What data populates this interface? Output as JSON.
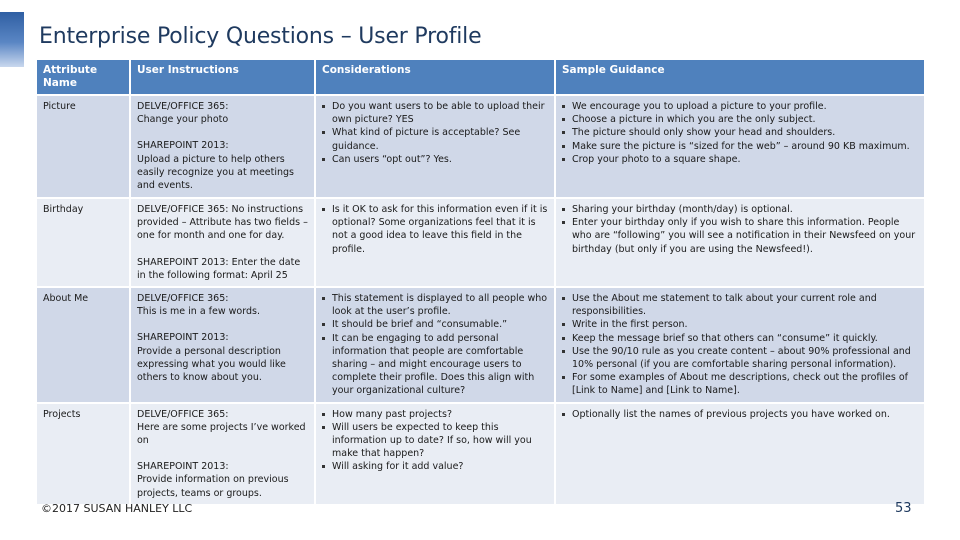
{
  "slide": {
    "title": "Enterprise Policy Questions – User Profile",
    "footer": "©2017 SUSAN HANLEY LLC",
    "page_number": "53",
    "colors": {
      "header_fill": "#4f81bd",
      "row_dark": "#d0d8e8",
      "row_light": "#e9edf4",
      "title_color": "#1f3a5f"
    }
  },
  "table": {
    "headers": [
      "Attribute Name",
      "User Instructions",
      "Considerations",
      "Sample Guidance"
    ],
    "rows": [
      {
        "attribute": "Picture",
        "instructions": [
          "DELVE/OFFICE 365:\nChange your photo",
          "SHAREPOINT 2013:\nUpload a picture to help others easily recognize you at meetings and events."
        ],
        "considerations": [
          "Do you want users to be able to upload their own picture? YES",
          "What kind of picture is acceptable? See guidance.",
          "Can users “opt out”? Yes."
        ],
        "guidance": [
          "We encourage you to upload a picture to your profile.",
          "Choose a picture in which you are the only subject.",
          "The picture should only show your head and shoulders.",
          "Make sure the picture is “sized for the web” – around 90 KB maximum.",
          "Crop your photo to a square shape."
        ]
      },
      {
        "attribute": "Birthday",
        "instructions": [
          "DELVE/OFFICE 365: No instructions provided – Attribute has two fields – one for month and one for day.",
          "SHAREPOINT 2013: Enter the date in the following format: April 25"
        ],
        "considerations": [
          "Is it OK to ask for this information even if it is optional? Some organizations feel that it is not a good idea to leave this field in the profile."
        ],
        "guidance": [
          "Sharing your birthday (month/day) is optional.",
          "Enter your birthday only if you wish to share this information. People who are “following” you will see a notification in their Newsfeed on your birthday (but only if you are using the Newsfeed!)."
        ]
      },
      {
        "attribute": "About Me",
        "instructions": [
          "DELVE/OFFICE 365:\nThis is me in a few words.",
          "SHAREPOINT 2013:\nProvide a personal description expressing what you would like others to know about you."
        ],
        "considerations": [
          "This statement is displayed to all people who look at the user’s profile.",
          "It should be brief and “consumable.”",
          "It can be engaging to add personal information that people are comfortable sharing – and might encourage users to complete their profile. Does this align with your organizational culture?"
        ],
        "guidance": [
          "Use the About me statement to talk about your current role and responsibilities.",
          "Write in the first person.",
          "Keep the message brief so that others can “consume” it quickly.",
          "Use the 90/10 rule as you create content – about 90% professional and 10% personal (if you are comfortable sharing personal information).",
          "For some examples of About me descriptions, check out the profiles of [Link to Name] and [Link to Name]."
        ]
      },
      {
        "attribute": "Projects",
        "instructions": [
          "DELVE/OFFICE 365:\nHere are some projects I’ve worked on",
          "SHAREPOINT 2013:\nProvide information on previous projects, teams or groups."
        ],
        "considerations": [
          "How many past projects?",
          "Will users be expected to keep this information up to date?  If so, how will you make that happen?",
          "Will asking for it add value?"
        ],
        "guidance": [
          "Optionally list the names of previous projects you have worked on."
        ]
      }
    ]
  }
}
